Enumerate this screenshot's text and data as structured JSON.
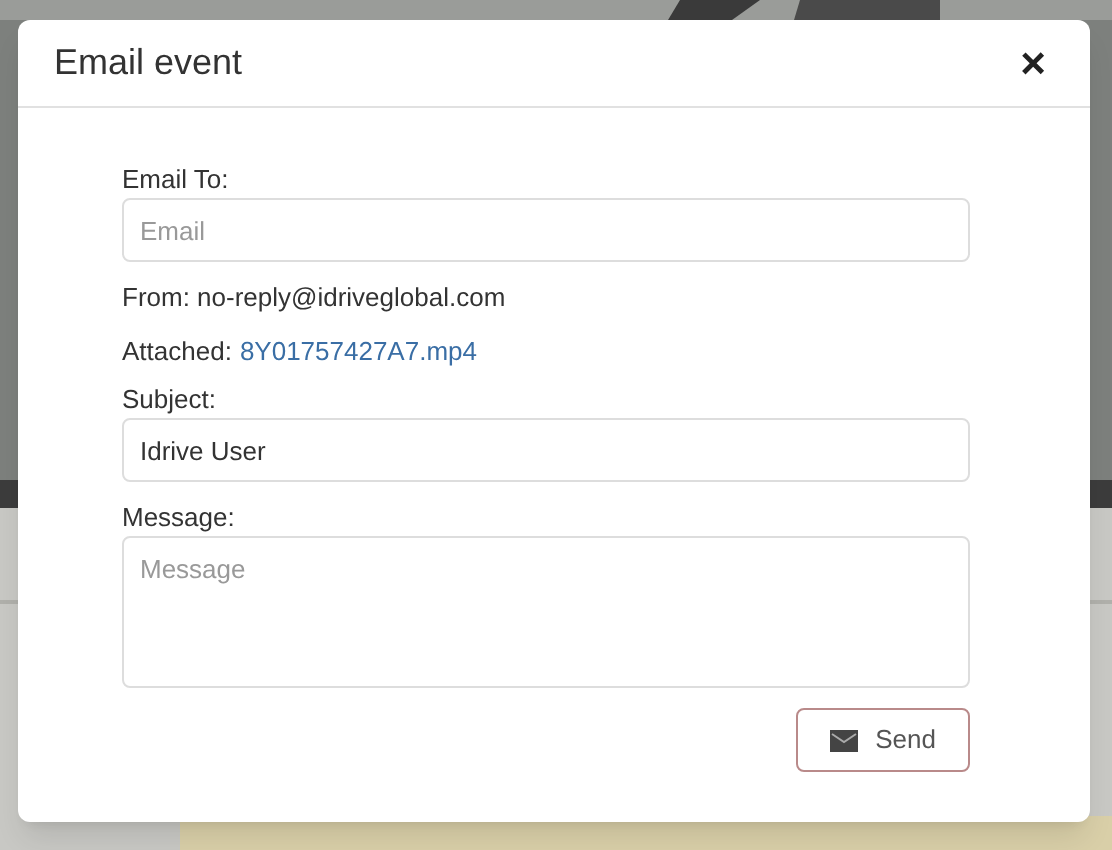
{
  "dialog": {
    "title": "Email event",
    "close": "×"
  },
  "form": {
    "to_label": "Email To:",
    "to_placeholder": "Email",
    "from": "From: no-reply@idriveglobal.com",
    "attached_label": "Attached:",
    "attached_file": "8Y01757427A7.mp4",
    "subject_label": "Subject:",
    "subject_value": "Idrive User",
    "message_label": "Message:",
    "message_placeholder": "Message"
  },
  "buttons": [
    {
      "label": "Send"
    }
  ]
}
